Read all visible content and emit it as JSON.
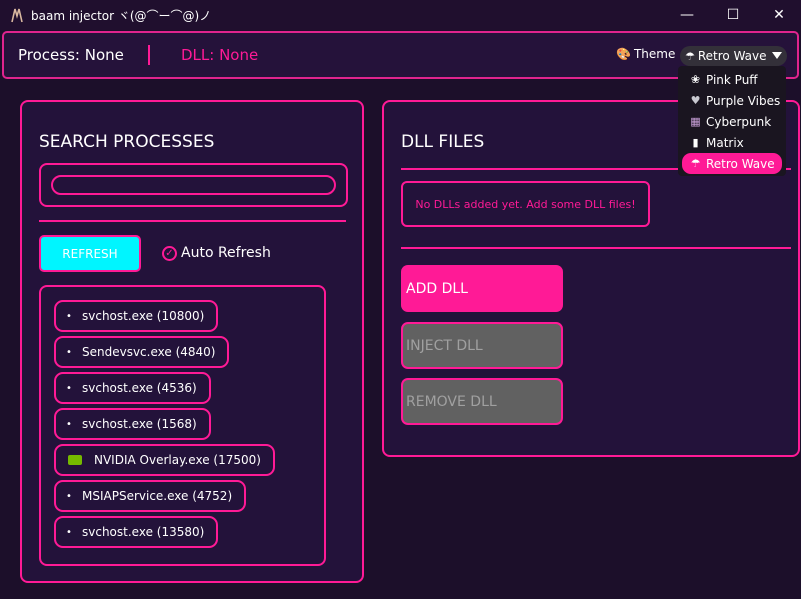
{
  "window": {
    "title": "baam injector ヾ(@⌒ー⌒@)ノ",
    "minimize": "—",
    "maximize": "☐",
    "close": "✕"
  },
  "topbar": {
    "process_label": "Process: None",
    "dll_label": "DLL: None",
    "theme_label": "Theme",
    "theme_value": "Retro Wave"
  },
  "theme_dropdown": {
    "options": [
      {
        "label": "Pink Puff",
        "icon": "❀"
      },
      {
        "label": "Purple Vibes",
        "icon": "♥"
      },
      {
        "label": "Cyberpunk",
        "icon": "▦"
      },
      {
        "label": "Matrix",
        "icon": "▮"
      },
      {
        "label": "Retro Wave",
        "icon": "☂"
      }
    ],
    "selected": "Retro Wave"
  },
  "search_panel": {
    "heading": "SEARCH PROCESSES",
    "search_value": "",
    "refresh_label": "REFRESH",
    "auto_refresh_label": "Auto Refresh",
    "auto_refresh_checked": true,
    "processes": [
      {
        "label": "svchost.exe (10800)",
        "icon": "•"
      },
      {
        "label": "Sendevsvc.exe (4840)",
        "icon": "•"
      },
      {
        "label": "svchost.exe (4536)",
        "icon": "•"
      },
      {
        "label": "svchost.exe (1568)",
        "icon": "•"
      },
      {
        "label": "NVIDIA Overlay.exe (17500)",
        "icon": "nvidia-icon"
      },
      {
        "label": "MSIAPService.exe (4752)",
        "icon": "•"
      },
      {
        "label": "svchost.exe (13580)",
        "icon": "•"
      }
    ]
  },
  "dll_panel": {
    "heading": "DLL FILES",
    "empty_message": "No DLLs added yet. Add some DLL files!",
    "add_label": "ADD DLL",
    "inject_label": "INJECT DLL",
    "remove_label": "REMOVE DLL"
  },
  "colors": {
    "accent": "#ff1a96",
    "cyan": "#00f5ff",
    "background": "#1c0f2a",
    "panel": "#23123a",
    "disabled": "#616161"
  }
}
